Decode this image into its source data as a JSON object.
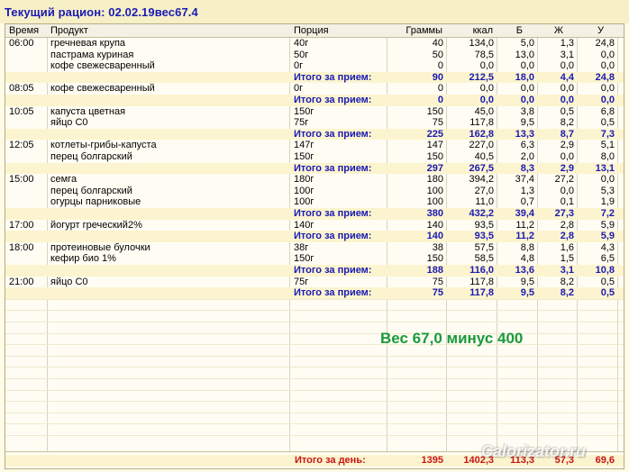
{
  "title": "Текущий рацион: 02.02.19вес67.4",
  "columns": {
    "time": "Время",
    "product": "Продукт",
    "portion": "Порция",
    "grams": "Граммы",
    "kcal": "ккал",
    "protein": "Б",
    "fat": "Ж",
    "carbs": "У"
  },
  "rows": [
    {
      "type": "item",
      "time": "06:00",
      "product": "гречневая крупа",
      "portion": "40г",
      "grams": "40",
      "kcal": "134,0",
      "protein": "5,0",
      "fat": "1,3",
      "carbs": "24,8"
    },
    {
      "type": "item",
      "time": "",
      "product": "пастрама куриная",
      "portion": "50г",
      "grams": "50",
      "kcal": "78,5",
      "protein": "13,0",
      "fat": "3,1",
      "carbs": "0,0"
    },
    {
      "type": "item",
      "time": "",
      "product": "кофе свежесваренный",
      "portion": "0г",
      "grams": "0",
      "kcal": "0,0",
      "protein": "0,0",
      "fat": "0,0",
      "carbs": "0,0"
    },
    {
      "type": "total",
      "label": "Итого за прием:",
      "grams": "90",
      "kcal": "212,5",
      "protein": "18,0",
      "fat": "4,4",
      "carbs": "24,8"
    },
    {
      "type": "item",
      "time": "08:05",
      "product": "кофе свежесваренный",
      "portion": "0г",
      "grams": "0",
      "kcal": "0,0",
      "protein": "0,0",
      "fat": "0,0",
      "carbs": "0,0"
    },
    {
      "type": "total",
      "label": "Итого за прием:",
      "grams": "0",
      "kcal": "0,0",
      "protein": "0,0",
      "fat": "0,0",
      "carbs": "0,0"
    },
    {
      "type": "item",
      "time": "10:05",
      "product": "капуста цветная",
      "portion": "150г",
      "grams": "150",
      "kcal": "45,0",
      "protein": "3,8",
      "fat": "0,5",
      "carbs": "6,8"
    },
    {
      "type": "item",
      "time": "",
      "product": "яйцо С0",
      "portion": "75г",
      "grams": "75",
      "kcal": "117,8",
      "protein": "9,5",
      "fat": "8,2",
      "carbs": "0,5"
    },
    {
      "type": "total",
      "label": "Итого за прием:",
      "grams": "225",
      "kcal": "162,8",
      "protein": "13,3",
      "fat": "8,7",
      "carbs": "7,3"
    },
    {
      "type": "item",
      "time": "12:05",
      "product": "котлеты-грибы-капуста",
      "portion": "147г",
      "grams": "147",
      "kcal": "227,0",
      "protein": "6,3",
      "fat": "2,9",
      "carbs": "5,1"
    },
    {
      "type": "item",
      "time": "",
      "product": "перец болгарский",
      "portion": "150г",
      "grams": "150",
      "kcal": "40,5",
      "protein": "2,0",
      "fat": "0,0",
      "carbs": "8,0"
    },
    {
      "type": "total",
      "label": "Итого за прием:",
      "grams": "297",
      "kcal": "267,5",
      "protein": "8,3",
      "fat": "2,9",
      "carbs": "13,1"
    },
    {
      "type": "item",
      "time": "15:00",
      "product": "семга",
      "portion": "180г",
      "grams": "180",
      "kcal": "394,2",
      "protein": "37,4",
      "fat": "27,2",
      "carbs": "0,0"
    },
    {
      "type": "item",
      "time": "",
      "product": "перец болгарский",
      "portion": "100г",
      "grams": "100",
      "kcal": "27,0",
      "protein": "1,3",
      "fat": "0,0",
      "carbs": "5,3"
    },
    {
      "type": "item",
      "time": "",
      "product": "огурцы парниковые",
      "portion": "100г",
      "grams": "100",
      "kcal": "11,0",
      "protein": "0,7",
      "fat": "0,1",
      "carbs": "1,9"
    },
    {
      "type": "total",
      "label": "Итого за прием:",
      "grams": "380",
      "kcal": "432,2",
      "protein": "39,4",
      "fat": "27,3",
      "carbs": "7,2"
    },
    {
      "type": "item",
      "time": "17:00",
      "product": "йогурт греческий2%",
      "portion": "140г",
      "grams": "140",
      "kcal": "93,5",
      "protein": "11,2",
      "fat": "2,8",
      "carbs": "5,9"
    },
    {
      "type": "total",
      "label": "Итого за прием:",
      "grams": "140",
      "kcal": "93,5",
      "protein": "11,2",
      "fat": "2,8",
      "carbs": "5,9"
    },
    {
      "type": "item",
      "time": "18:00",
      "product": "протеиновые булочки",
      "portion": "38г",
      "grams": "38",
      "kcal": "57,5",
      "protein": "8,8",
      "fat": "1,6",
      "carbs": "4,3"
    },
    {
      "type": "item",
      "time": "",
      "product": "кефир био 1%",
      "portion": "150г",
      "grams": "150",
      "kcal": "58,5",
      "protein": "4,8",
      "fat": "1,5",
      "carbs": "6,5"
    },
    {
      "type": "total",
      "label": "Итого за прием:",
      "grams": "188",
      "kcal": "116,0",
      "protein": "13,6",
      "fat": "3,1",
      "carbs": "10,8"
    },
    {
      "type": "item",
      "time": "21:00",
      "product": "яйцо С0",
      "portion": "75г",
      "grams": "75",
      "kcal": "117,8",
      "protein": "9,5",
      "fat": "8,2",
      "carbs": "0,5"
    },
    {
      "type": "total",
      "label": "Итого за прием:",
      "grams": "75",
      "kcal": "117,8",
      "protein": "9,5",
      "fat": "8,2",
      "carbs": "0,5"
    }
  ],
  "weight_note": "Вес 67,0 минус 400",
  "day_total": {
    "label": "Итого за день:",
    "grams": "1395",
    "kcal": "1402,3",
    "protein": "113,3",
    "fat": "57,3",
    "carbs": "69,6"
  },
  "watermark": "Calorizator.ru",
  "colors": {
    "title": "#1a1ab4",
    "meal_total": "#1a1ab4",
    "day_total": "#c81414",
    "weight_note": "#1a9a3c"
  }
}
